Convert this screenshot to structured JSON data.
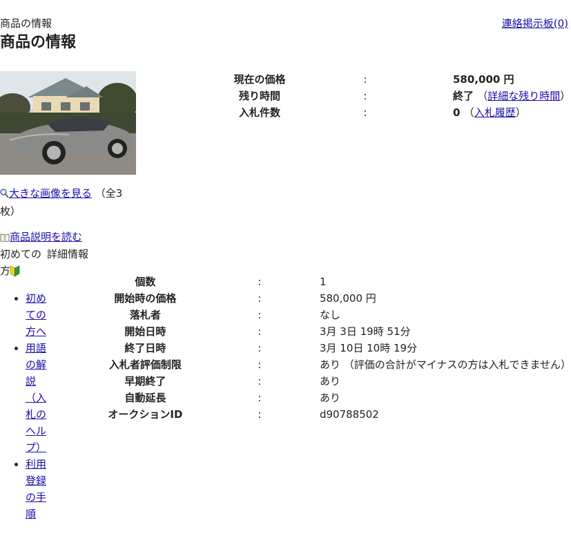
{
  "header": {
    "breadcrumb": "商品の情報",
    "board_link": "連絡掲示板(0)",
    "title": "商品の情報"
  },
  "summary": {
    "rows": [
      {
        "label": "現在の価格",
        "sep": ":",
        "value": "580,000 円"
      },
      {
        "label": "残り時間",
        "sep": ":",
        "value": "終了"
      },
      {
        "label": "入札件数",
        "sep": ":",
        "value": "0"
      }
    ],
    "remaining_paren_open": "（",
    "remaining_link": "詳細な残り時間",
    "remaining_paren_close": "）",
    "bids_paren_open": "（",
    "bids_link": "入札履歴",
    "bids_paren_close": "）"
  },
  "image": {
    "enlarge_link": "大きな画像を見る",
    "count_text": "（全3枚）"
  },
  "description": {
    "read_link": "商品説明を読む"
  },
  "beginner": {
    "title": "初めての方",
    "detail_heading": "詳細情報",
    "links": [
      "初めての方へ",
      "用語の解説（入札のヘルプ）",
      "利用登録の手順"
    ]
  },
  "details": {
    "rows": [
      {
        "label": "個数",
        "sep": ":",
        "value": "1"
      },
      {
        "label": "開始時の価格",
        "sep": ":",
        "value": "580,000 円"
      },
      {
        "label": "落札者",
        "sep": ":",
        "value": "なし"
      },
      {
        "label": "開始日時",
        "sep": ":",
        "value": "3月 3日 19時 51分"
      },
      {
        "label": "終了日時",
        "sep": ":",
        "value": "3月 10日 10時 19分"
      },
      {
        "label": "入札者評価制限",
        "sep": ":",
        "value": "あり （評価の合計がマイナスの方は入札できません）"
      },
      {
        "label": "早期終了",
        "sep": ":",
        "value": "あり"
      },
      {
        "label": "自動延長",
        "sep": ":",
        "value": "あり"
      },
      {
        "label": "オークションID",
        "sep": ":",
        "value": "d90788502"
      }
    ]
  },
  "colors": {
    "link": "#1a0dab",
    "text": "#222222",
    "beginner_mark_yellow": "#f2d21b",
    "beginner_mark_green": "#2e9b3a"
  },
  "icons": [
    "magnifier-icon",
    "book-icon",
    "beginner-mark-icon"
  ]
}
